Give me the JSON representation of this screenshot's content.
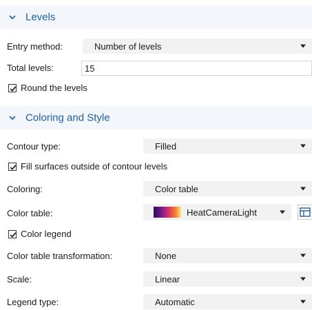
{
  "levels_section": {
    "title": "Levels"
  },
  "entry_method": {
    "label": "Entry method:",
    "value": "Number of levels"
  },
  "total_levels": {
    "label": "Total levels:",
    "value": "15"
  },
  "round_levels": {
    "label": "Round the levels",
    "checked": true
  },
  "coloring_section": {
    "title": "Coloring and Style"
  },
  "contour_type": {
    "label": "Contour type:",
    "value": "Filled"
  },
  "fill_surfaces": {
    "label": "Fill surfaces outside of contour levels",
    "checked": true
  },
  "coloring": {
    "label": "Coloring:",
    "value": "Color table"
  },
  "color_table": {
    "label": "Color table:",
    "value": "HeatCameraLight"
  },
  "color_legend": {
    "label": "Color legend",
    "checked": true
  },
  "color_table_transformation": {
    "label": "Color table transformation:",
    "value": "None"
  },
  "scale": {
    "label": "Scale:",
    "value": "Linear"
  },
  "legend_type": {
    "label": "Legend type:",
    "value": "Automatic"
  },
  "colors": {
    "header_bg": "#f3f6fa",
    "header_text": "#1f5f9e",
    "field_bg": "#f2f2f2"
  }
}
